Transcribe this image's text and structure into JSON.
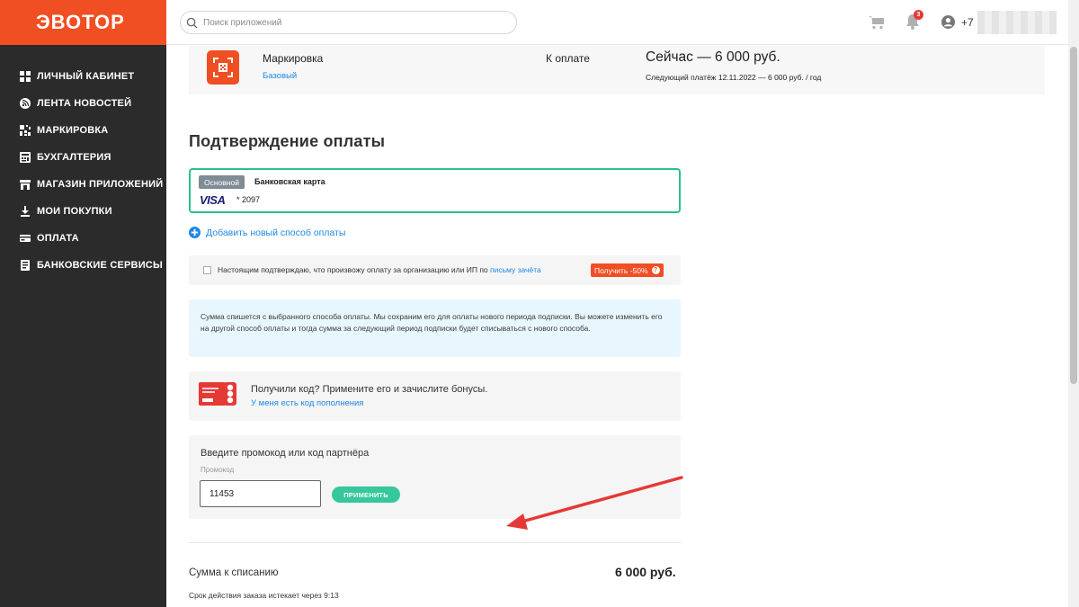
{
  "brand": {
    "logo": "ЭВОТОР",
    "accent": "#f04e23",
    "sidebar_bg": "#2b2b2b",
    "green": "#2bbf8f",
    "link": "#1e88e5"
  },
  "sidebar": {
    "items": [
      {
        "label": "ЛИЧНЫЙ КАБИНЕТ",
        "icon": "grid-icon"
      },
      {
        "label": "ЛЕНТА НОВОСТЕЙ",
        "icon": "rss-icon"
      },
      {
        "label": "МАРКИРОВКА",
        "icon": "qr-icon"
      },
      {
        "label": "БУХГАЛТЕРИЯ",
        "icon": "calculator-icon"
      },
      {
        "label": "МАГАЗИН ПРИЛОЖЕНИЙ",
        "icon": "store-icon"
      },
      {
        "label": "МОИ ПОКУПКИ",
        "icon": "download-icon"
      },
      {
        "label": "ОПЛАТА",
        "icon": "credit-card-icon"
      },
      {
        "label": "БАНКОВСКИЕ СЕРВИСЫ",
        "icon": "bank-icon"
      }
    ]
  },
  "header": {
    "search_placeholder": "Поиск приложений",
    "notifications_count": "3",
    "phone_prefix": "+7"
  },
  "product": {
    "name": "Маркировка",
    "plan": "Базовый",
    "pay_label": "К оплате",
    "pay_now": "Сейчас — 6 000 руб.",
    "next_payment": "Следующий платёж 12.11.2022 — 6 000 руб. / год"
  },
  "confirmation": {
    "title": "Подтверждение оплаты",
    "card": {
      "tag": "Основной",
      "type": "Банковская карта",
      "brand": "VISA",
      "number": "* 2097"
    },
    "add_method": "Добавить новый способ оплаты",
    "org_confirm_text": "Настоящим подтверждаю, что произвожу оплату за организацию или ИП по",
    "org_confirm_link": "письму зачёта",
    "discount_label": "Получить -50%",
    "info_text": "Сумма спишется с выбранного способа оплаты. Мы сохраним его для оплаты нового периода подписки. Вы можете изменить его на другой способ оплаты и тогда сумма за следующий период подписки будет списываться с нового способа."
  },
  "bonus": {
    "title": "Получили код? Примените его и зачислите бонусы.",
    "link": "У меня есть код пополнения"
  },
  "promo": {
    "title": "Введите промокод или код партнёра",
    "label": "Промокод",
    "value": "11453",
    "apply_label": "ПРИМЕНИТЬ"
  },
  "summary": {
    "label": "Сумма к списанию",
    "value": "6 000 руб.",
    "expires": "Срок действия заказа истекает через 9:13"
  }
}
